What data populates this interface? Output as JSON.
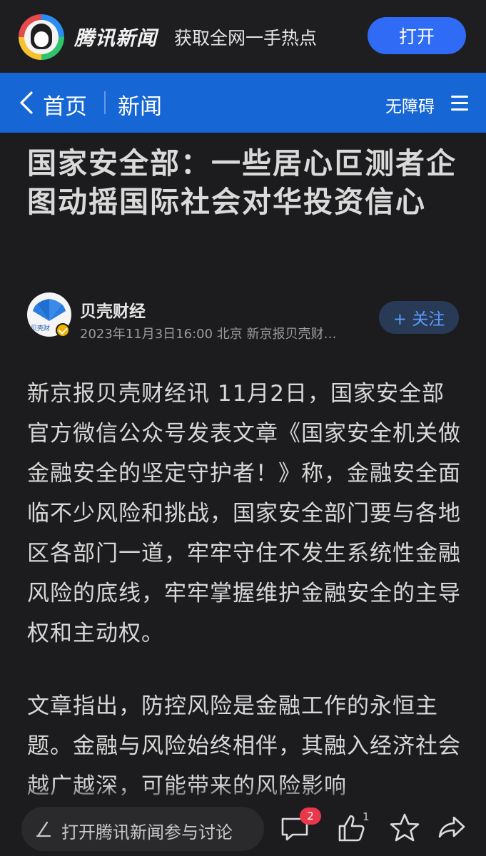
{
  "banner": {
    "app_name": "腾讯新闻",
    "slogan": "获取全网一手热点",
    "open_label": "打开"
  },
  "nav": {
    "home_label": "首页",
    "section_label": "新闻",
    "accessibility_label": "无障碍"
  },
  "article": {
    "title": "国家安全部：一些居心叵测者企图动摇国际社会对华投资信心",
    "author": "贝壳财经",
    "avatar_text": "贝壳财",
    "meta": "2023年11月3日16:00  北京  新京报贝壳财…",
    "follow_label": "+ 关注",
    "paragraphs": [
      "新京报贝壳财经讯 11月2日，国家安全部官方微信公众号发表文章《国家安全机关做金融安全的坚定守护者！》称，金融安全面临不少风险和挑战，国家安全部门要与各地区各部门一道，牢牢守住不发生系统性金融风险的底线，牢牢掌握维护金融安全的主导权和主动权。",
      "文章指出，防控风险是金融工作的永恒主题。金融与风险始终相伴，其融入经济社会越广越深，可能带来的风险影响"
    ]
  },
  "bottom_bar": {
    "comment_placeholder": "打开腾讯新闻参与讨论",
    "comment_count": "2",
    "like_count": "1"
  },
  "colors": {
    "nav_blue": "#1666d5",
    "open_button": "#2f6bf5",
    "badge_red": "#e8384a",
    "background": "#1c1c1e"
  },
  "icons": [
    "back-icon",
    "menu-icon",
    "pen-icon",
    "comment-icon",
    "thumbs-up-icon",
    "star-icon",
    "share-icon",
    "verified-icon"
  ]
}
